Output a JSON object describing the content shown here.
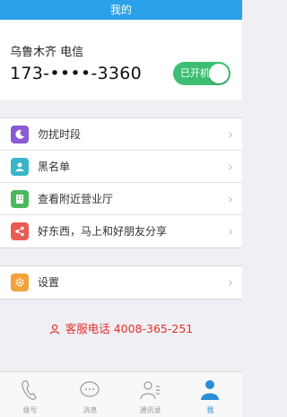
{
  "header": {
    "title": "我的"
  },
  "account": {
    "carrier": "乌鲁木齐 电信",
    "phone": "173-••••-3360",
    "toggle_label": "已开机",
    "toggle_on": true
  },
  "menu": {
    "items": [
      {
        "label": "勿扰时段",
        "icon": "moon-icon",
        "color": "#8a5bd3"
      },
      {
        "label": "黑名单",
        "icon": "blacklist-user-icon",
        "color": "#37b6c9"
      },
      {
        "label": "查看附近营业厅",
        "icon": "building-icon",
        "color": "#4cb85d"
      },
      {
        "label": "好东西，马上和好朋友分享",
        "icon": "share-icon",
        "color": "#ea5b54"
      }
    ],
    "settings": {
      "label": "设置",
      "icon": "gear-icon",
      "color": "#f2a23a"
    }
  },
  "hotline": {
    "text": "客服电话 4008-365-251",
    "color": "#e1322b"
  },
  "tabbar": {
    "tabs": [
      {
        "label": "拨号",
        "icon": "phone-icon"
      },
      {
        "label": "消息",
        "icon": "message-icon"
      },
      {
        "label": "通讯录",
        "icon": "contacts-icon"
      },
      {
        "label": "我",
        "icon": "profile-icon",
        "active": true
      }
    ]
  },
  "colors": {
    "accent": "#2aa1e8",
    "toggle": "#3cbf73",
    "active_tab": "#2a8fd6"
  }
}
